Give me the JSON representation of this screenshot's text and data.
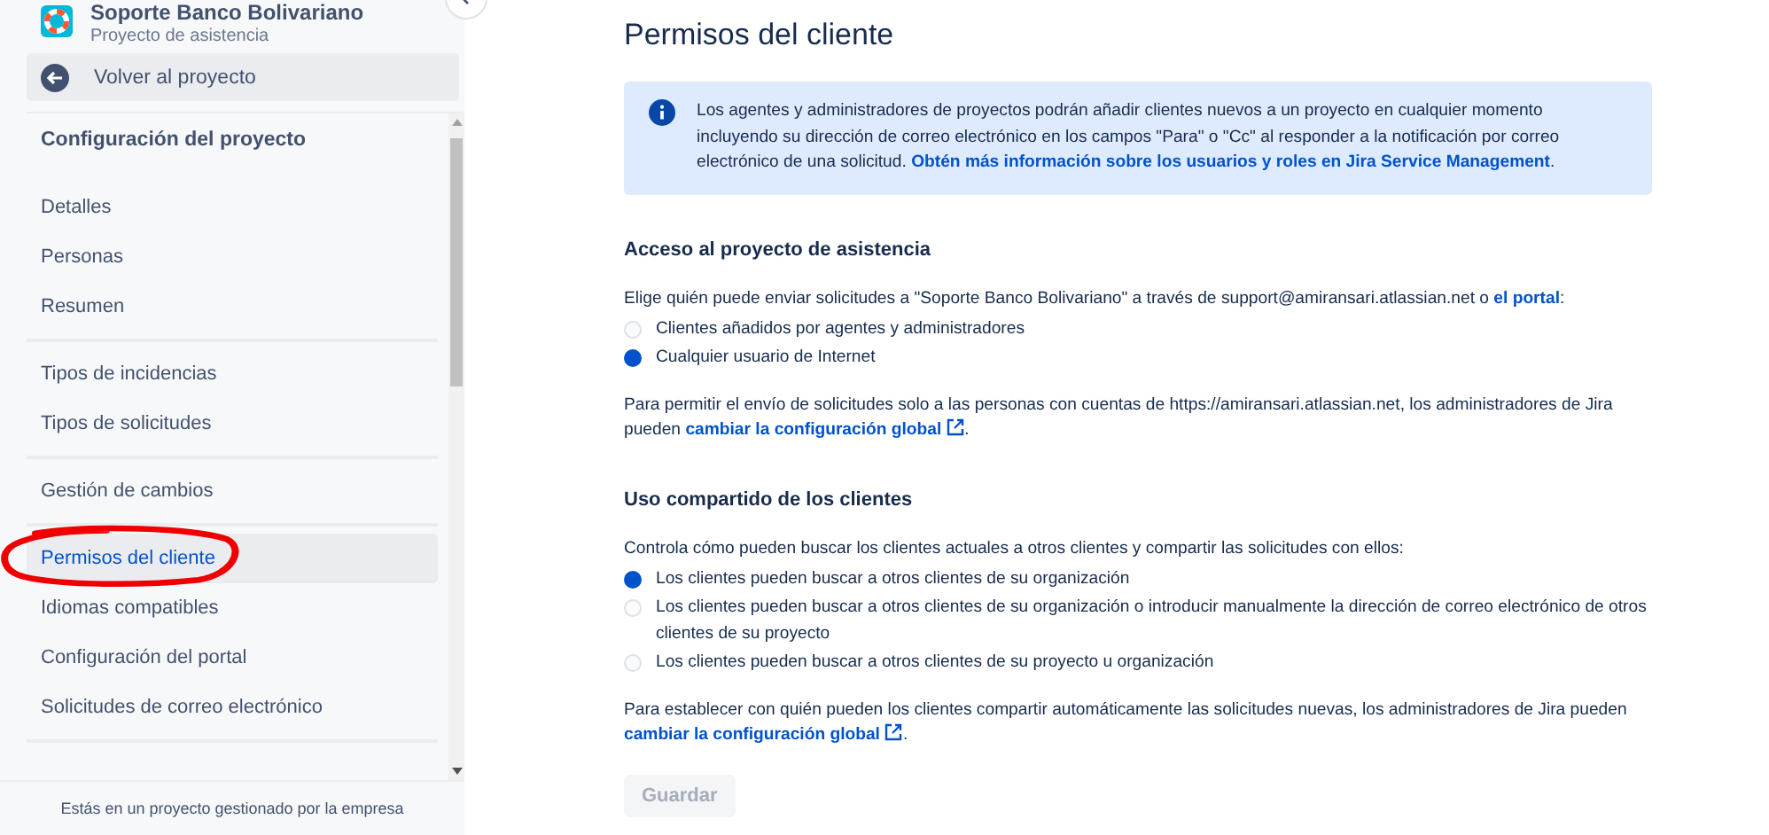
{
  "sidebar": {
    "project": {
      "name": "Soporte Banco Bolivariano",
      "type": "Proyecto de asistencia"
    },
    "back_button": "Volver al proyecto",
    "section_title": "Configuración del proyecto",
    "groups": [
      [
        {
          "label": "Detalles",
          "selected": false
        },
        {
          "label": "Personas",
          "selected": false
        },
        {
          "label": "Resumen",
          "selected": false
        }
      ],
      [
        {
          "label": "Tipos de incidencias",
          "selected": false
        },
        {
          "label": "Tipos de solicitudes",
          "selected": false
        }
      ],
      [
        {
          "label": "Gestión de cambios",
          "selected": false
        }
      ],
      [
        {
          "label": "Permisos del cliente",
          "selected": true
        },
        {
          "label": "Idiomas compatibles",
          "selected": false
        },
        {
          "label": "Configuración del portal",
          "selected": false
        },
        {
          "label": "Solicitudes de correo electrónico",
          "selected": false
        }
      ]
    ],
    "footer": "Estás en un proyecto gestionado por la empresa"
  },
  "main": {
    "title": "Permisos del cliente",
    "info": {
      "text": "Los agentes y administradores de proyectos podrán añadir clientes nuevos a un proyecto en cualquier momento incluyendo su dirección de correo electrónico en los campos \"Para\" o \"Cc\" al responder a la notificación por correo electrónico de una solicitud. ",
      "link": "Obtén más información sobre los usuarios y roles en Jira Service Management",
      "after": "."
    },
    "sections": [
      {
        "heading": "Acceso al proyecto de asistencia",
        "description": {
          "text": "Elige quién puede enviar solicitudes a \"Soporte Banco Bolivariano\" a través de support@amiransari.atlassian.net o ",
          "link": "el portal",
          "after": ":"
        },
        "options": [
          {
            "label": "Clientes añadidos por agentes y administradores",
            "selected": false
          },
          {
            "label": "Cualquier usuario de Internet",
            "selected": true
          }
        ],
        "note": {
          "text": "Para permitir el envío de solicitudes solo a las personas con cuentas de https://amiransari.atlassian.net, los administradores de Jira pueden ",
          "link": "cambiar la configuración global",
          "after": "."
        }
      },
      {
        "heading": "Uso compartido de los clientes",
        "description": {
          "text": "Controla cómo pueden buscar los clientes actuales a otros clientes y compartir las solicitudes con ellos:"
        },
        "options": [
          {
            "label": "Los clientes pueden buscar a otros clientes de su organización",
            "selected": true
          },
          {
            "label": "Los clientes pueden buscar a otros clientes de su organización o introducir manualmente la dirección de correo electrónico de otros clientes de su proyecto",
            "selected": false
          },
          {
            "label": "Los clientes pueden buscar a otros clientes de su proyecto u organización",
            "selected": false
          }
        ],
        "note": {
          "text": "Para establecer con quién pueden los clientes compartir automáticamente las solicitudes nuevas, los administradores de Jira pueden ",
          "link": "cambiar la configuración global",
          "after": "."
        }
      }
    ],
    "save_button": {
      "label": "Guardar",
      "disabled": true
    }
  }
}
